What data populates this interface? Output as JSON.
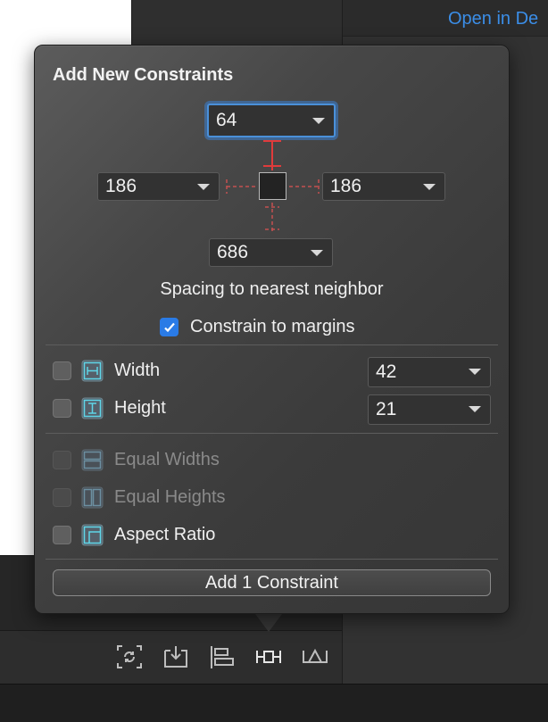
{
  "background": {
    "open_link": "Open in De"
  },
  "popover": {
    "title": "Add New Constraints",
    "spacing": {
      "top": "64",
      "leading": "186",
      "trailing": "186",
      "bottom": "686"
    },
    "spacing_label": "Spacing to nearest neighbor",
    "constrain_to_margins": {
      "label": "Constrain to margins",
      "checked": true
    },
    "size": [
      {
        "label": "Width",
        "value": "42",
        "checked": false
      },
      {
        "label": "Height",
        "value": "21",
        "checked": false
      }
    ],
    "equal": [
      {
        "label": "Equal Widths",
        "enabled": false
      },
      {
        "label": "Equal Heights",
        "enabled": false
      },
      {
        "label": "Aspect Ratio",
        "enabled": true
      }
    ],
    "add_button": "Add 1 Constraint"
  },
  "toolbar": {
    "icons": [
      "update-frames-icon",
      "embed-in-stack-icon",
      "align-icon",
      "add-constraints-icon",
      "resolve-issues-icon"
    ]
  },
  "colors": {
    "accent": "#2a7be6",
    "constraint_red": "#e03b3b",
    "icon_cyan": "#5fd6e8",
    "link": "#3b8ee8"
  }
}
